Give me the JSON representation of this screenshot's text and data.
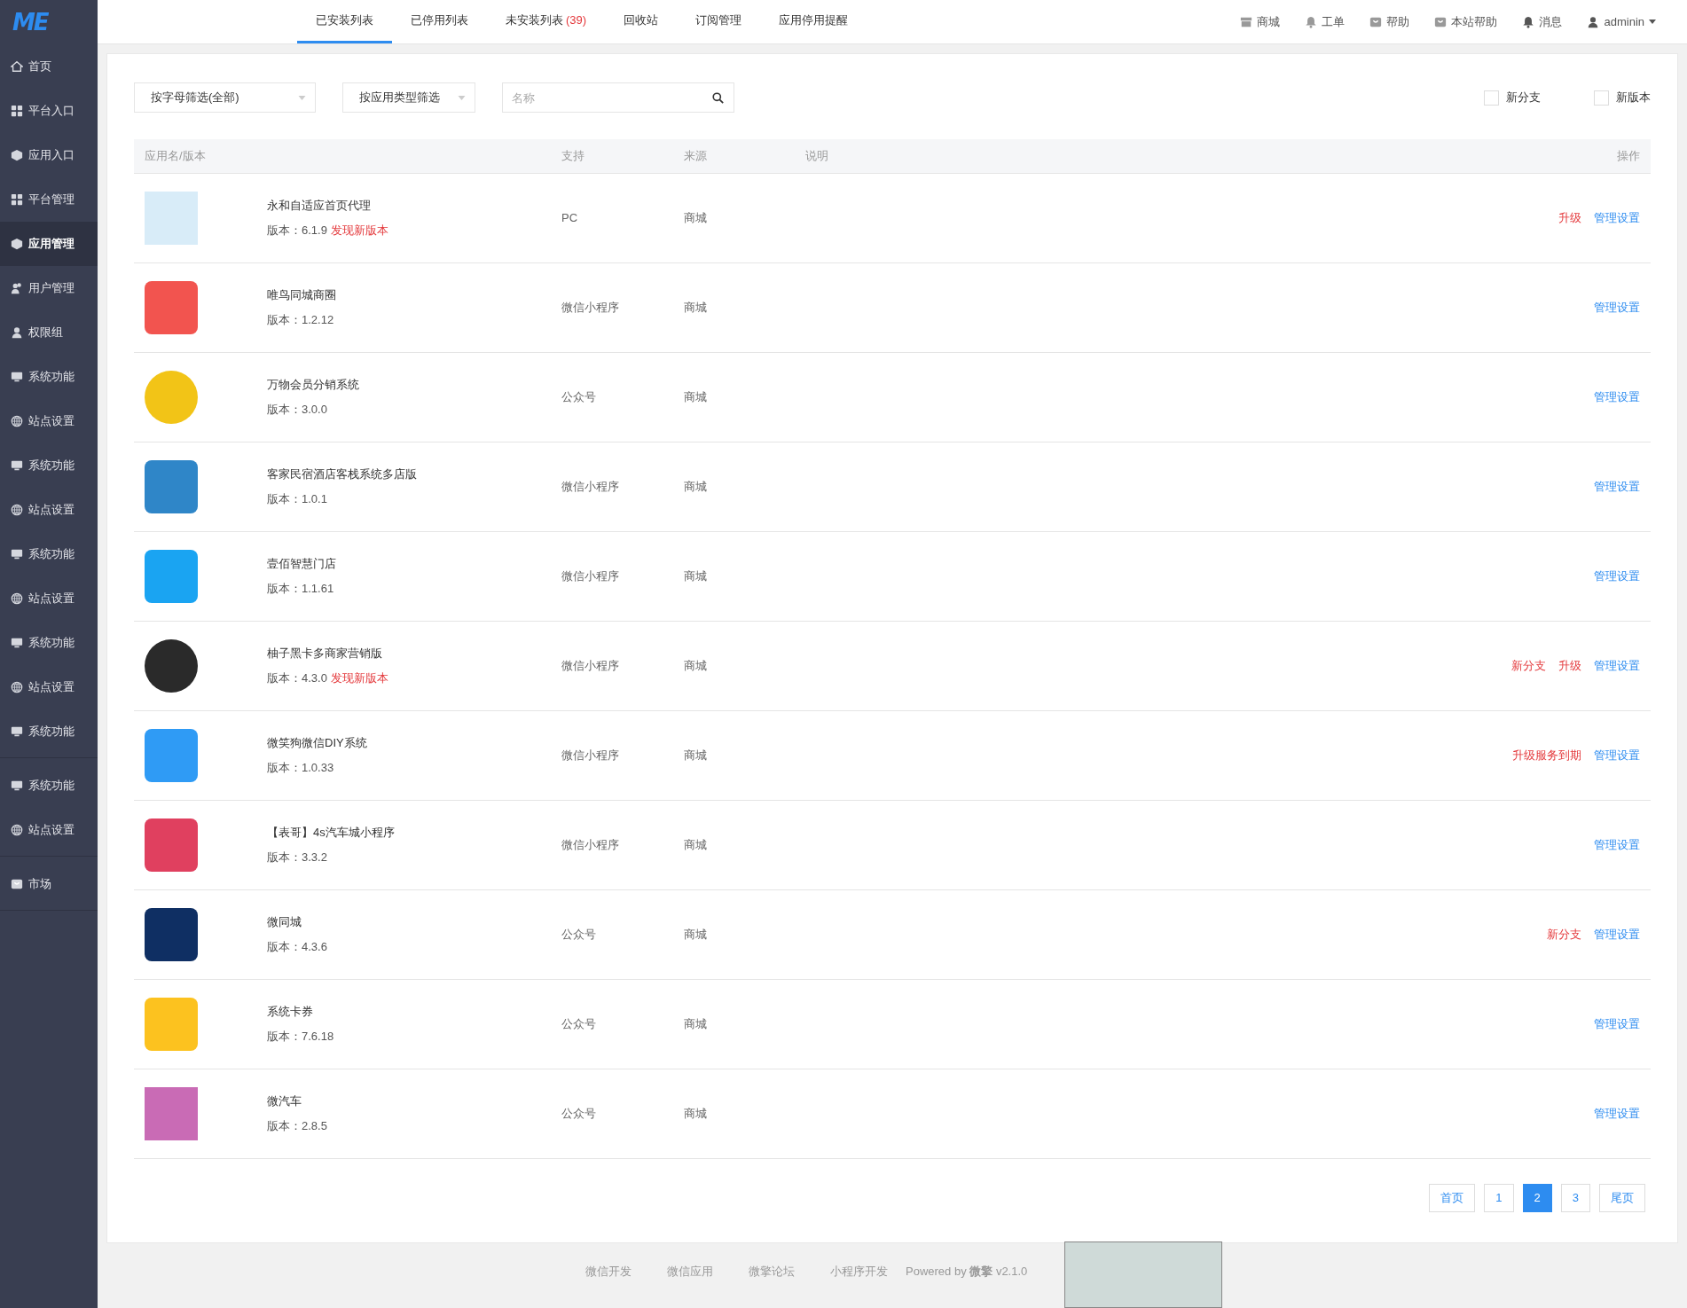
{
  "logo": "ME",
  "sidebar": {
    "groups": [
      [
        {
          "label": "首页",
          "kind": "home",
          "selected": false
        },
        {
          "label": "平台入口",
          "kind": "grid",
          "selected": false
        },
        {
          "label": "应用入口",
          "kind": "cube",
          "selected": false
        },
        {
          "label": "平台管理",
          "kind": "grid",
          "selected": false
        },
        {
          "label": "应用管理",
          "kind": "cube",
          "selected": true
        },
        {
          "label": "用户管理",
          "kind": "users",
          "selected": false
        },
        {
          "label": "权限组",
          "kind": "user",
          "selected": false
        },
        {
          "label": "系统功能",
          "kind": "monitor",
          "selected": false
        },
        {
          "label": "站点设置",
          "kind": "globe",
          "selected": false
        },
        {
          "label": "系统功能",
          "kind": "monitor",
          "selected": false
        },
        {
          "label": "站点设置",
          "kind": "globe",
          "selected": false
        },
        {
          "label": "系统功能",
          "kind": "monitor",
          "selected": false
        },
        {
          "label": "站点设置",
          "kind": "globe",
          "selected": false
        },
        {
          "label": "系统功能",
          "kind": "monitor",
          "selected": false
        },
        {
          "label": "站点设置",
          "kind": "globe",
          "selected": false
        },
        {
          "label": "系统功能",
          "kind": "monitor",
          "selected": false
        }
      ],
      [
        {
          "label": "系统功能",
          "kind": "monitor",
          "selected": false
        },
        {
          "label": "站点设置",
          "kind": "globe",
          "selected": false
        }
      ],
      [
        {
          "label": "市场",
          "kind": "bag",
          "selected": false
        }
      ]
    ]
  },
  "tabs": [
    {
      "label": "已安装列表",
      "selected": true
    },
    {
      "label": "已停用列表",
      "selected": false
    },
    {
      "label": "未安装列表",
      "count": "(39)",
      "selected": false
    },
    {
      "label": "回收站",
      "selected": false
    },
    {
      "label": "订阅管理",
      "selected": false
    },
    {
      "label": "应用停用提醒",
      "selected": false
    }
  ],
  "top_links": [
    {
      "label": "商城",
      "kind": "store"
    },
    {
      "label": "工单",
      "kind": "bell"
    },
    {
      "label": "帮助",
      "kind": "bag"
    },
    {
      "label": "本站帮助",
      "kind": "bag"
    },
    {
      "label": "消息",
      "kind": "bell-dark"
    },
    {
      "label": "adminin",
      "kind": "user"
    }
  ],
  "filters": {
    "dropdowns": [
      "按字母筛选(全部)",
      "按应用类型筛选"
    ],
    "search": {
      "placeholder": "名称"
    },
    "checkboxes": [
      {
        "label": "新分支",
        "checked": false
      },
      {
        "label": "新版本",
        "checked": false
      }
    ]
  },
  "table": {
    "columns": [
      "应用名/版本",
      "支持",
      "来源",
      "说明",
      "操作"
    ],
    "rows": [
      {
        "icon": {
          "kind": "square",
          "color": "#d8ecf8"
        },
        "name": "永和自适应首页代理",
        "version": "版本：6.1.9",
        "note": "发现新版本",
        "support": "PC",
        "source": "商城",
        "actions": [
          {
            "label": "升级",
            "kind": "danger"
          },
          {
            "label": "管理设置",
            "kind": "link"
          }
        ]
      },
      {
        "icon": {
          "kind": "rounded",
          "color": "#f2544f"
        },
        "name": "唯鸟同城商圈",
        "version": "版本：1.2.12",
        "support": "微信小程序",
        "source": "商城",
        "actions": [
          {
            "label": "管理设置",
            "kind": "link"
          }
        ]
      },
      {
        "icon": {
          "kind": "circle",
          "color": "#f2c417"
        },
        "name": "万物会员分销系统",
        "version": "版本：3.0.0",
        "support": "公众号",
        "source": "商城",
        "actions": [
          {
            "label": "管理设置",
            "kind": "link"
          }
        ]
      },
      {
        "icon": {
          "kind": "rounded",
          "color": "#2f86c8"
        },
        "name": "客家民宿酒店客栈系统多店版",
        "version": "版本：1.0.1",
        "support": "微信小程序",
        "source": "商城",
        "actions": [
          {
            "label": "管理设置",
            "kind": "link"
          }
        ]
      },
      {
        "icon": {
          "kind": "rounded",
          "color": "#1aa4f2"
        },
        "name": "壹佰智慧门店",
        "version": "版本：1.1.61",
        "support": "微信小程序",
        "source": "商城",
        "actions": [
          {
            "label": "管理设置",
            "kind": "link"
          }
        ]
      },
      {
        "icon": {
          "kind": "circle",
          "color": "#2a2a2a"
        },
        "name": "柚子黑卡多商家营销版",
        "version": "版本：4.3.0",
        "note": "发现新版本",
        "support": "微信小程序",
        "source": "商城",
        "actions": [
          {
            "label": "新分支",
            "kind": "danger"
          },
          {
            "label": "升级",
            "kind": "danger"
          },
          {
            "label": "管理设置",
            "kind": "link"
          }
        ]
      },
      {
        "icon": {
          "kind": "rounded",
          "color": "#2f9bf5"
        },
        "name": "微笑狗微信DIY系统",
        "version": "版本：1.0.33",
        "support": "微信小程序",
        "source": "商城",
        "actions": [
          {
            "label": "升级服务到期",
            "kind": "danger"
          },
          {
            "label": "管理设置",
            "kind": "link"
          }
        ]
      },
      {
        "icon": {
          "kind": "rounded",
          "color": "#e0405f"
        },
        "name": "【表哥】4s汽车城小程序",
        "version": "版本：3.3.2",
        "support": "微信小程序",
        "source": "商城",
        "actions": [
          {
            "label": "管理设置",
            "kind": "link"
          }
        ]
      },
      {
        "icon": {
          "kind": "rounded",
          "color": "#0f2f63"
        },
        "name": "微同城",
        "version": "版本：4.3.6",
        "support": "公众号",
        "source": "商城",
        "actions": [
          {
            "label": "新分支",
            "kind": "danger"
          },
          {
            "label": "管理设置",
            "kind": "link"
          }
        ]
      },
      {
        "icon": {
          "kind": "rounded",
          "color": "#fcc21f"
        },
        "name": "系统卡券",
        "version": "版本：7.6.18",
        "support": "公众号",
        "source": "商城",
        "actions": [
          {
            "label": "管理设置",
            "kind": "link"
          }
        ]
      },
      {
        "icon": {
          "kind": "square",
          "color": "#c96bb5"
        },
        "name": "微汽车",
        "version": "版本：2.8.5",
        "support": "公众号",
        "source": "商城",
        "actions": [
          {
            "label": "管理设置",
            "kind": "link"
          }
        ]
      }
    ]
  },
  "pagination": [
    {
      "label": "首页",
      "selected": false
    },
    {
      "label": "1",
      "selected": false
    },
    {
      "label": "2",
      "selected": true
    },
    {
      "label": "3",
      "selected": false
    },
    {
      "label": "尾页",
      "selected": false
    }
  ],
  "footer": {
    "links": [
      "微信开发",
      "微信应用",
      "微擎论坛",
      "小程序开发"
    ],
    "powered": "Powered by **微擎** v2.1.0"
  }
}
